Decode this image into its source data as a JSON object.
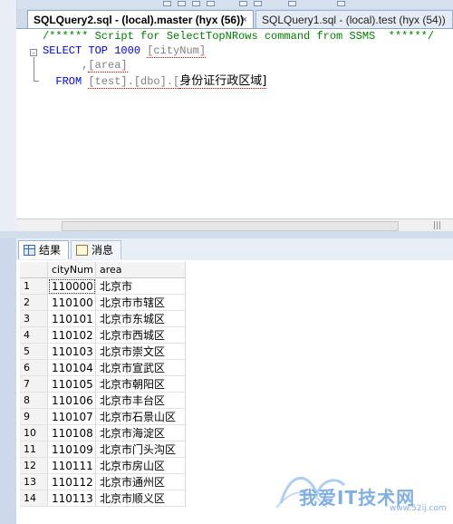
{
  "tabs": [
    {
      "label": "SQLQuery2.sql - (local).master (hyx (56))",
      "close": "×",
      "active": true
    },
    {
      "label": "SQLQuery1.sql - (local).test (hyx (54))",
      "active": false
    }
  ],
  "editor": {
    "line1": "/****** Script for SelectTopNRows command from SSMS  ******/",
    "line2_kw": "SELECT TOP 1000",
    "line2_col": "[cityNum]",
    "line3_prefix": "      ,",
    "line3_col": "[area]",
    "line4_kw": "  FROM",
    "line4_table": "[test].[dbo].[",
    "line4_name": "身份证行政区域]",
    "fold_glyph": "-"
  },
  "results_tabs": {
    "results": "结果",
    "messages": "消息"
  },
  "grid": {
    "columns": [
      "cityNum",
      "area"
    ],
    "rows": [
      [
        "1",
        "110000",
        "北京市"
      ],
      [
        "2",
        "110100",
        "北京市市辖区"
      ],
      [
        "3",
        "110101",
        "北京市东城区"
      ],
      [
        "4",
        "110102",
        "北京市西城区"
      ],
      [
        "5",
        "110103",
        "北京市崇文区"
      ],
      [
        "6",
        "110104",
        "北京市宣武区"
      ],
      [
        "7",
        "110105",
        "北京市朝阳区"
      ],
      [
        "8",
        "110106",
        "北京市丰台区"
      ],
      [
        "9",
        "110107",
        "北京市石景山区"
      ],
      [
        "10",
        "110108",
        "北京市海淀区"
      ],
      [
        "11",
        "110109",
        "北京市门头沟区"
      ],
      [
        "12",
        "110111",
        "北京市房山区"
      ],
      [
        "13",
        "110112",
        "北京市通州区"
      ],
      [
        "14",
        "110113",
        "北京市顺义区"
      ]
    ]
  },
  "watermark": {
    "text": "我爱IT技术网",
    "sub": "www.52ij.com"
  },
  "colors": {
    "keyword": "#0000ff",
    "comment": "#008000",
    "identifier": "#808080",
    "chrome": "#cdd9ea"
  }
}
